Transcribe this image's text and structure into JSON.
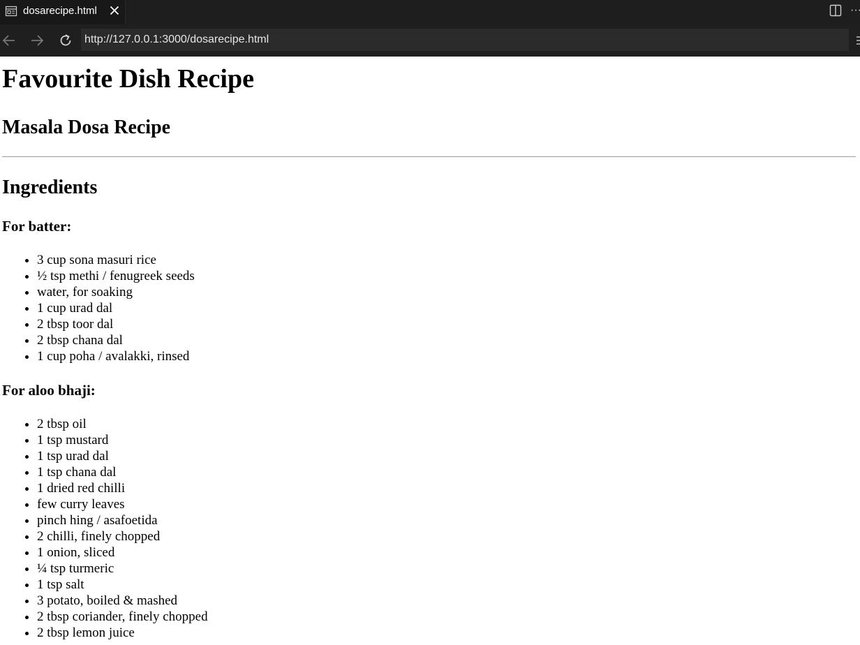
{
  "browser": {
    "tab": {
      "title": "dosarecipe.html"
    },
    "address": {
      "url": "http://127.0.0.1:3000/dosarecipe.html"
    },
    "icons": {
      "tab": "page-icon",
      "close": "close-icon",
      "split": "split-editor-icon",
      "more": "more-icon",
      "back": "arrow-left-icon",
      "forward": "arrow-right-icon",
      "reload": "reload-icon"
    },
    "colors": {
      "tab_bar": "#1e1e1e",
      "active_tab": "#181818",
      "address_box": "#2b2b2b",
      "text": "#ffffff"
    }
  },
  "page": {
    "title": "Favourite Dish Recipe",
    "subtitle": "Masala Dosa Recipe",
    "ingredients_heading": "Ingredients",
    "batter": {
      "heading": "For batter:",
      "items": [
        "3 cup sona masuri rice",
        "½ tsp methi / fenugreek seeds",
        "water, for soaking",
        "1 cup urad dal",
        "2 tbsp toor dal",
        "2 tbsp chana dal",
        "1 cup poha / avalakki, rinsed"
      ]
    },
    "bhaji": {
      "heading": "For aloo bhaji:",
      "items": [
        "2 tbsp oil",
        "1 tsp mustard",
        "1 tsp urad dal",
        "1 tsp chana dal",
        "1 dried red chilli",
        "few curry leaves",
        "pinch hing / asafoetida",
        "2 chilli, finely chopped",
        "1 onion, sliced",
        "¼ tsp turmeric",
        "1 tsp salt",
        "3 potato, boiled & mashed",
        "2 tbsp coriander, finely chopped",
        "2 tbsp lemon juice"
      ]
    }
  }
}
